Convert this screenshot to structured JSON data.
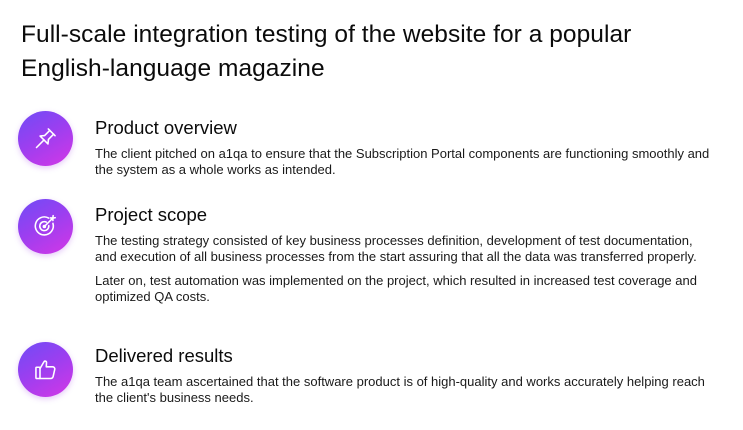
{
  "page": {
    "title": "Full-scale integration testing of the website for a popular English-language magazine"
  },
  "colors": {
    "icon_gradient_start": "#6f4cf6",
    "icon_gradient_end": "#d437e6",
    "text": "#111111"
  },
  "sections": [
    {
      "icon": "pin-icon",
      "heading": "Product overview",
      "paragraphs": [
        "The client pitched on a1qa to ensure that the Subscription Portal components are functioning smoothly and the system as a whole works as intended."
      ]
    },
    {
      "icon": "target-icon",
      "heading": "Project scope",
      "paragraphs": [
        "The testing strategy consisted of key business processes definition, development of test documentation, and execution of all business processes from the start assuring that all the data was transferred properly.",
        "Later on, test automation was implemented on the project, which resulted in increased test coverage and optimized QA costs."
      ]
    },
    {
      "icon": "thumbs-up-icon",
      "heading": "Delivered results",
      "paragraphs": [
        "The a1qa team ascertained that the software product is of high-quality and works accurately helping reach the client's business needs."
      ]
    }
  ]
}
